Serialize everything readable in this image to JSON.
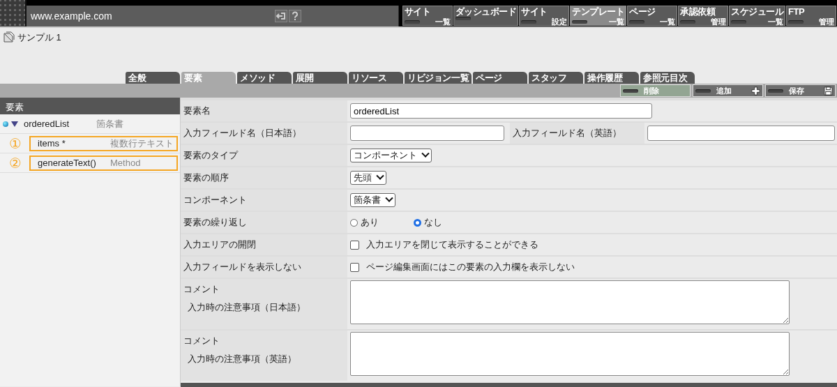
{
  "header": {
    "url": "www.example.com"
  },
  "menu": [
    {
      "top": "サイト",
      "bottom": "一覧",
      "selected": false
    },
    {
      "top": "ダッシュボード",
      "selected": false
    },
    {
      "top": "サイト",
      "bottom": "設定",
      "selected": false
    },
    {
      "top": "テンプレート",
      "bottom": "一覧",
      "selected": true
    },
    {
      "top": "ページ",
      "bottom": "一覧",
      "selected": false
    },
    {
      "top": "承認依頼",
      "bottom": "管理",
      "selected": false
    },
    {
      "top": "スケジュール",
      "bottom": "一覧",
      "selected": false
    },
    {
      "top": "FTP",
      "bottom": "管理",
      "selected": false
    }
  ],
  "page_title": "サンプル 1",
  "tabs": [
    {
      "label": "全般",
      "selected": false
    },
    {
      "label": "要素",
      "selected": true
    },
    {
      "label": "メソッド",
      "selected": false
    },
    {
      "label": "展開",
      "selected": false
    },
    {
      "label": "リソース",
      "selected": false
    },
    {
      "label": "リビジョン一覧",
      "selected": false
    },
    {
      "label": "ページ",
      "selected": false
    },
    {
      "label": "スタッフ",
      "selected": false
    },
    {
      "label": "操作履歴",
      "selected": false
    },
    {
      "label": "参照元目次",
      "selected": false
    }
  ],
  "actions": [
    {
      "label": "削除",
      "kind": "delete",
      "selected": true
    },
    {
      "label": "追加",
      "kind": "add",
      "selected": false
    },
    {
      "label": "保存",
      "kind": "save",
      "selected": false
    }
  ],
  "sidebar": {
    "title": "要素",
    "items": [
      {
        "name": "orderedList",
        "type": "箇条書",
        "expanded": true,
        "children": [
          {
            "name": "items *",
            "type": "複数行テキスト",
            "marker": "①",
            "highlighted": true
          },
          {
            "name": "generateText()",
            "type": "Method",
            "marker": "②",
            "highlighted": true
          }
        ]
      }
    ]
  },
  "form": [
    {
      "kind": "text",
      "label": "要素名",
      "value": "orderedList"
    },
    {
      "kind": "text_pair",
      "label": "入力フィールド名（日本語）",
      "label2": "入力フィールド名（英語）"
    },
    {
      "kind": "select",
      "label": "要素のタイプ",
      "value": "コンポーネント"
    },
    {
      "kind": "select",
      "label": "要素の順序",
      "value": "先頭"
    },
    {
      "kind": "select",
      "label": "コンポーネント",
      "value": "箇条書"
    },
    {
      "kind": "radio",
      "label": "要素の繰り返し",
      "options": [
        {
          "label": "あり",
          "selected": false
        },
        {
          "label": "なし",
          "selected": true
        }
      ]
    },
    {
      "kind": "checkbox",
      "label": "入力エリアの開閉",
      "option": "入力エリアを閉じて表示することができる",
      "checked": false
    },
    {
      "kind": "checkbox",
      "label": "入力フィールドを表示しない",
      "option": "ページ編集画面にはこの要素の入力欄を表示しない",
      "checked": false
    },
    {
      "kind": "textarea",
      "label": "コメント",
      "sublabel": "入力時の注意事項（日本語）"
    },
    {
      "kind": "textarea",
      "label": "コメント",
      "sublabel": "入力時の注意事項（英語）"
    }
  ]
}
